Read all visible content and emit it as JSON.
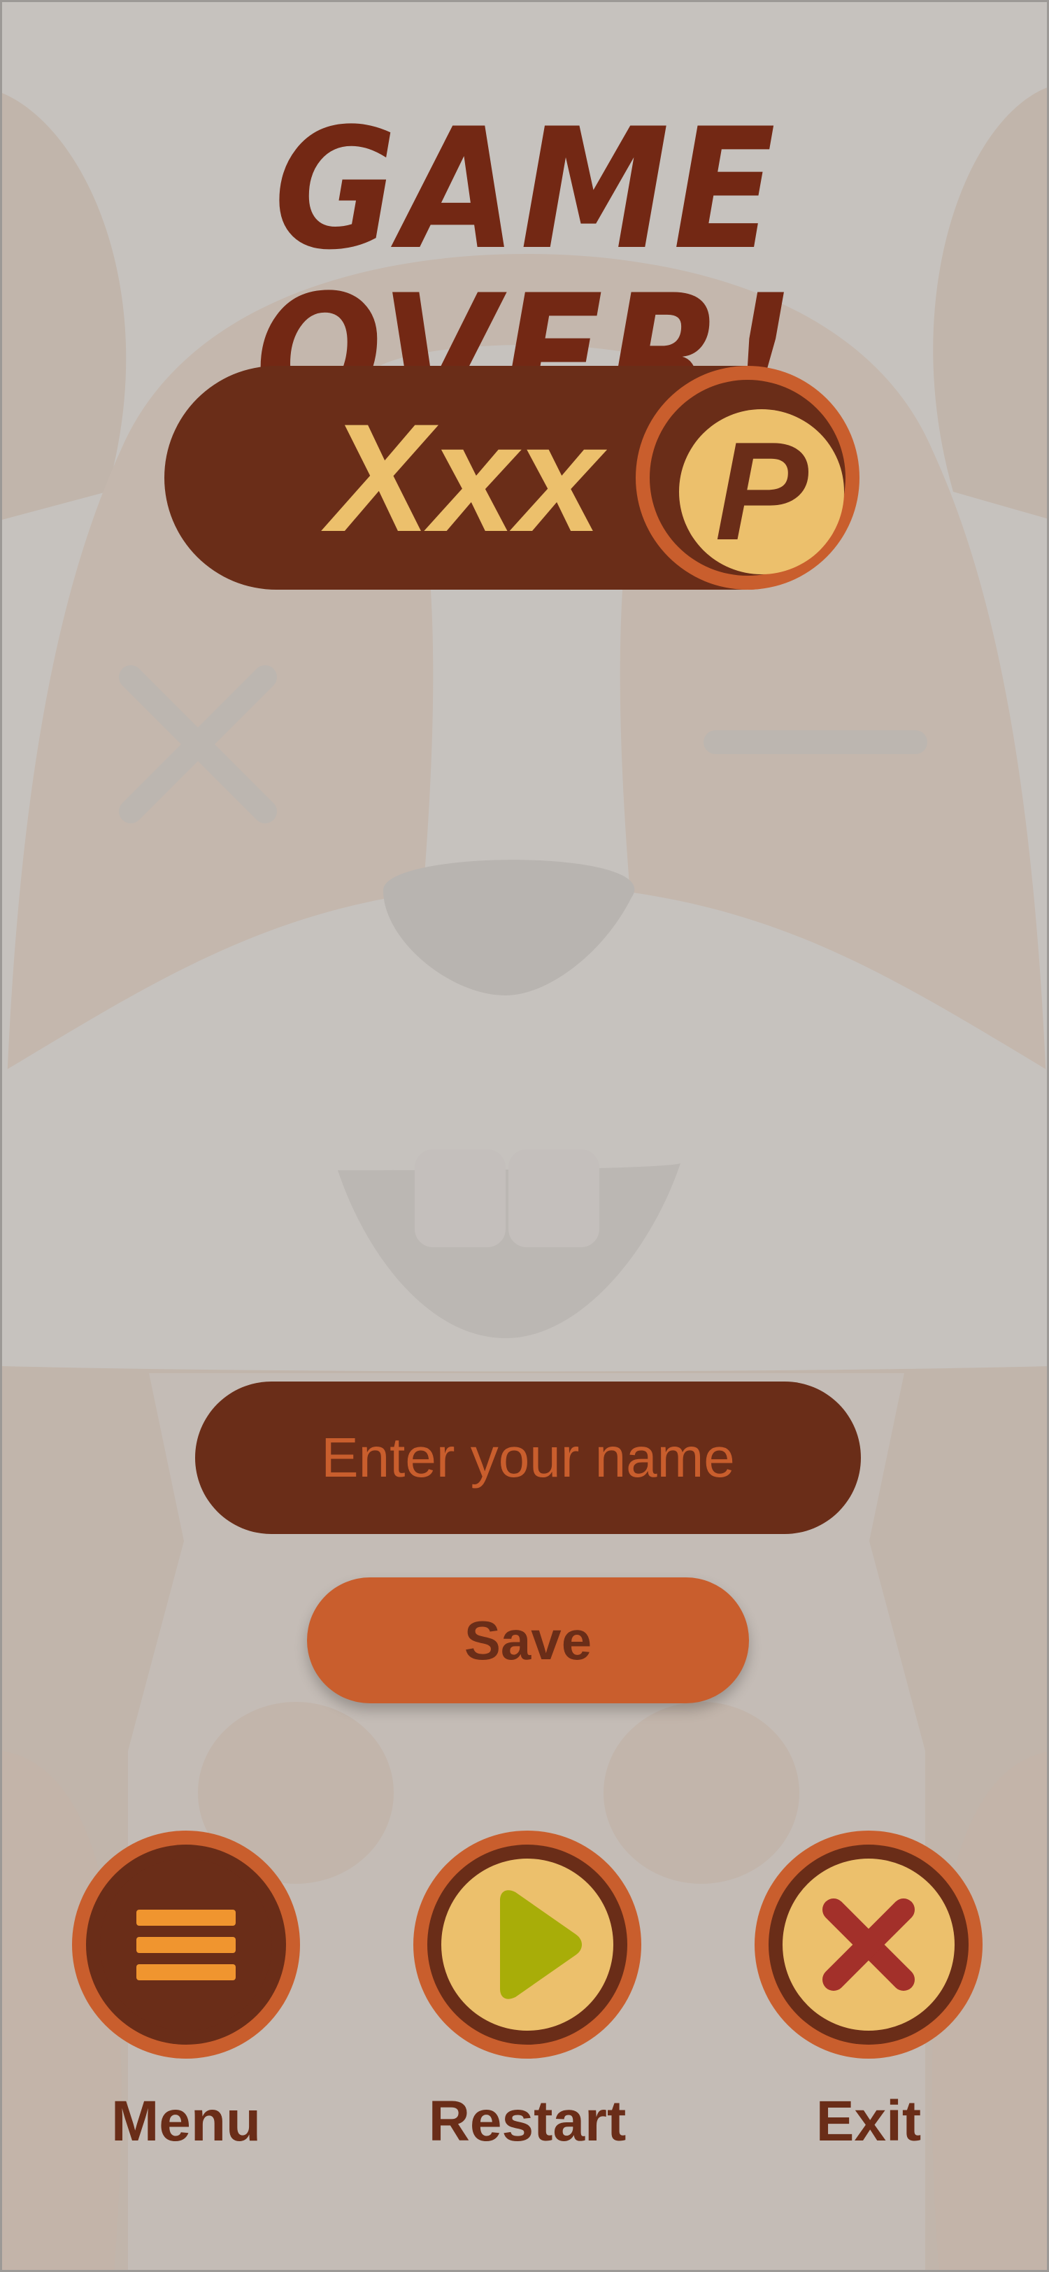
{
  "title": "GAME OVER!",
  "score": {
    "value": "Xxx",
    "currency_symbol": "P",
    "currency_icon": "coin-icon"
  },
  "name_entry": {
    "placeholder": "Enter your name",
    "value": ""
  },
  "save_button": {
    "label": "Save"
  },
  "actions": [
    {
      "id": "menu",
      "label": "Menu",
      "icon": "hamburger-icon"
    },
    {
      "id": "restart",
      "label": "Restart",
      "icon": "play-icon"
    },
    {
      "id": "exit",
      "label": "Exit",
      "icon": "close-icon"
    }
  ],
  "colors": {
    "background": "#c6c2be",
    "dark_brown": "#6a2d18",
    "title_brown": "#732814",
    "orange": "#c95e2d",
    "gold": "#ecc06c",
    "menu_icon_orange": "#f0952f",
    "play_icon_green": "#a8ad08",
    "exit_icon_red": "#a3302a"
  },
  "background_character": "squirrel-face-illustration"
}
